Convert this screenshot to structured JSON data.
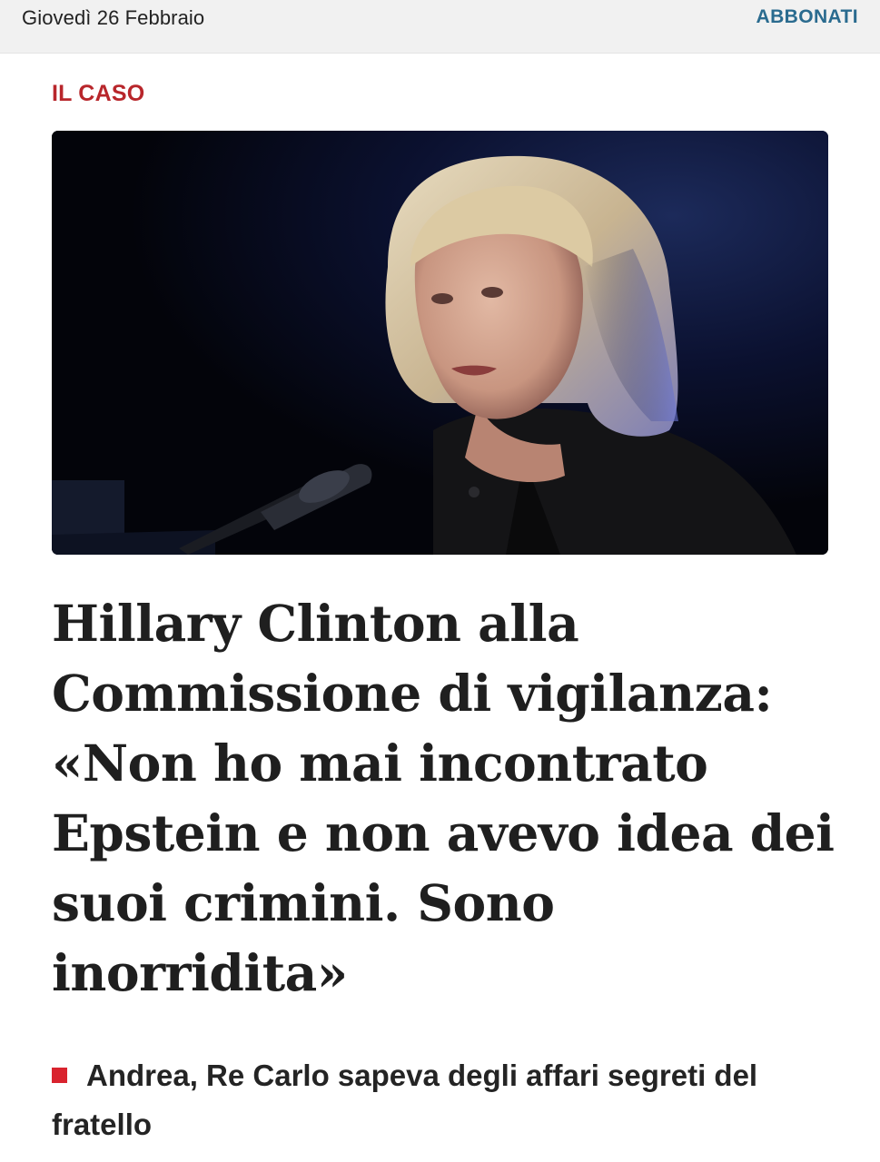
{
  "header": {
    "date": "Giovedì 26 Febbraio",
    "subscribe_label": "ABBONATI"
  },
  "article": {
    "kicker": "IL CASO",
    "headline": "Hillary Clinton alla Commissione di vigilanza: «Non ho mai incontrato Epstein e non avevo idea dei suoi crimini. Sono inorridita»",
    "image_icon": "photo-of-speaker-at-microphone"
  },
  "related": {
    "title": "Andrea, Re Carlo sapeva degli affari segreti del fratello"
  },
  "colors": {
    "accent_red": "#b8262b",
    "bullet_red": "#d9232e",
    "link_blue": "#2a6b8f",
    "topbar_bg": "#f1f1f1",
    "text_dark": "#1f1f1f"
  }
}
